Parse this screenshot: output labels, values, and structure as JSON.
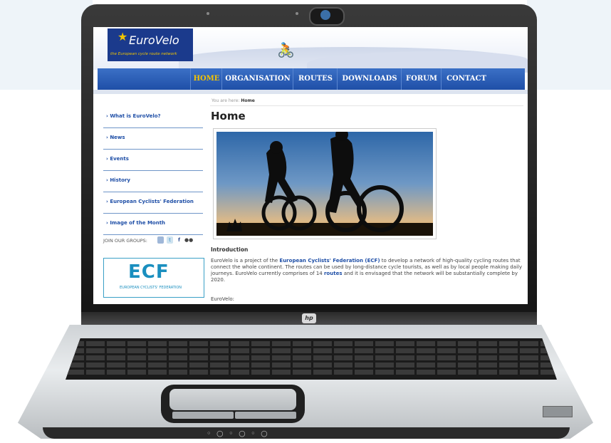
{
  "site": {
    "logo_text": "EuroVelo",
    "logo_tagline": "the European cycle route network"
  },
  "nav": {
    "items": [
      "HOME",
      "ORGANISATION",
      "ROUTES",
      "DOWNLOADS",
      "FORUM",
      "CONTACT"
    ],
    "active": "HOME"
  },
  "breadcrumb": {
    "prefix": "You are here:",
    "current": "Home"
  },
  "sidebar": {
    "items": [
      "› What is EuroVelo?",
      "› News",
      "› Events",
      "› History",
      "› European Cyclists' Federation",
      "› Image of the Month"
    ],
    "join_label": "JOIN OUR GROUPS:",
    "ecf_logo": "ECF",
    "ecf_caption": "EUROPEAN CYCLISTS' FEDERATION"
  },
  "main": {
    "title": "Home",
    "section_title": "Introduction",
    "intro_1": "EuroVelo is a project of the ",
    "intro_link1": "European Cyclists' Federation (ECF)",
    "intro_2": " to develop a network of high-quality cycling routes that connect the whole continent.  The routes can be used by long-distance cycle tourists, as well as by local people making daily journeys.  EuroVelo currently comprises of 14 ",
    "intro_link2": "routes",
    "intro_3": " and it is envisaged that the network will be substantially complete by 2020.",
    "eurovelo_label": "EuroVelo:"
  },
  "laptop": {
    "brand": "hp"
  },
  "colors": {
    "nav_blue": "#1f4fa7",
    "accent_yellow": "#f5c400"
  }
}
